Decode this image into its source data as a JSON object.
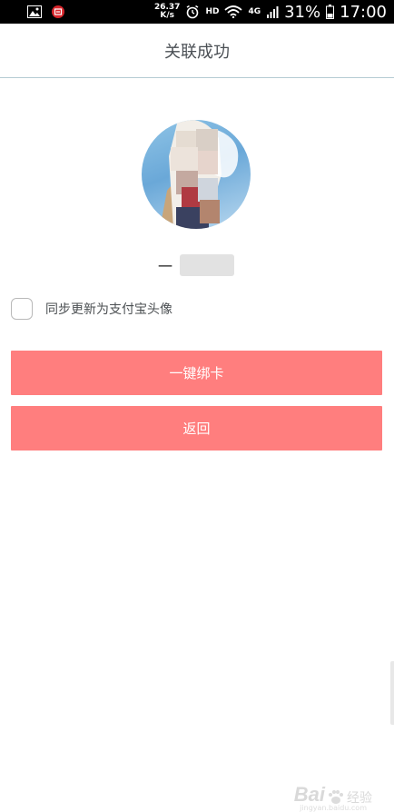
{
  "status_bar": {
    "speed_value": "26.37",
    "speed_unit": "K/s",
    "hd": "HD",
    "network": "4G",
    "battery": "31%",
    "time": "17:00"
  },
  "header": {
    "title": "关联成功"
  },
  "profile": {
    "nickname": "一"
  },
  "sync": {
    "label": "同步更新为支付宝头像",
    "checked": false
  },
  "buttons": {
    "bind": "一键绑卡",
    "back": "返回"
  },
  "watermark": {
    "brand": "Bai",
    "suffix": "经验",
    "url": "jingyan.baidu.com"
  },
  "colors": {
    "accent": "#ff7e7e",
    "divider": "#b5cbd3"
  }
}
